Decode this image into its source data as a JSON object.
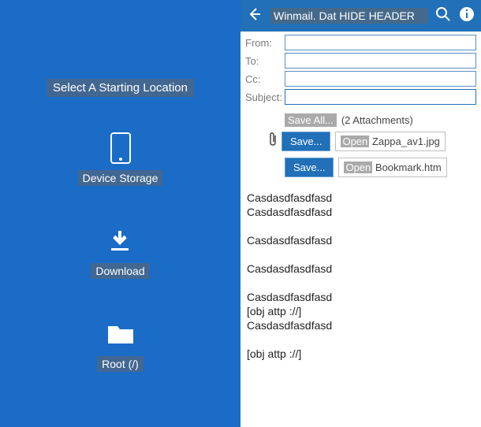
{
  "left": {
    "title": "Select A Starting Location",
    "items": [
      {
        "label": "Device Storage",
        "icon": "phone"
      },
      {
        "label": "Download",
        "icon": "download"
      },
      {
        "label": "Root (/)",
        "icon": "folder"
      }
    ]
  },
  "header": {
    "title": "Winmail. Dat HIDE HEADER"
  },
  "fields": {
    "from_label": "From:",
    "to_label": "To:",
    "cc_label": "Cc:",
    "subject_label": "Subject:",
    "from_value": "",
    "to_value": "",
    "cc_value": "",
    "subject_value": ""
  },
  "attachments": {
    "save_all": "Save All...",
    "count_text": "(2 Attachments)",
    "rows": [
      {
        "save": "Save...",
        "open_prefix": "Open",
        "filename": "Zappa_av1.jpg"
      },
      {
        "save": "Save...",
        "open_prefix": "Open",
        "filename": "Bookmark.htm"
      }
    ]
  },
  "body": {
    "lines": [
      "Casdasdfasdfasd",
      "Casdasdfasdfasd",
      "",
      "Casdasdfasdfasd",
      "",
      "Casdasdfasdfasd",
      "",
      "Casdasdfasdfasd",
      "[obj attp ://]",
      "Casdasdfasdfasd",
      "",
      "[obj attp ://]"
    ]
  }
}
